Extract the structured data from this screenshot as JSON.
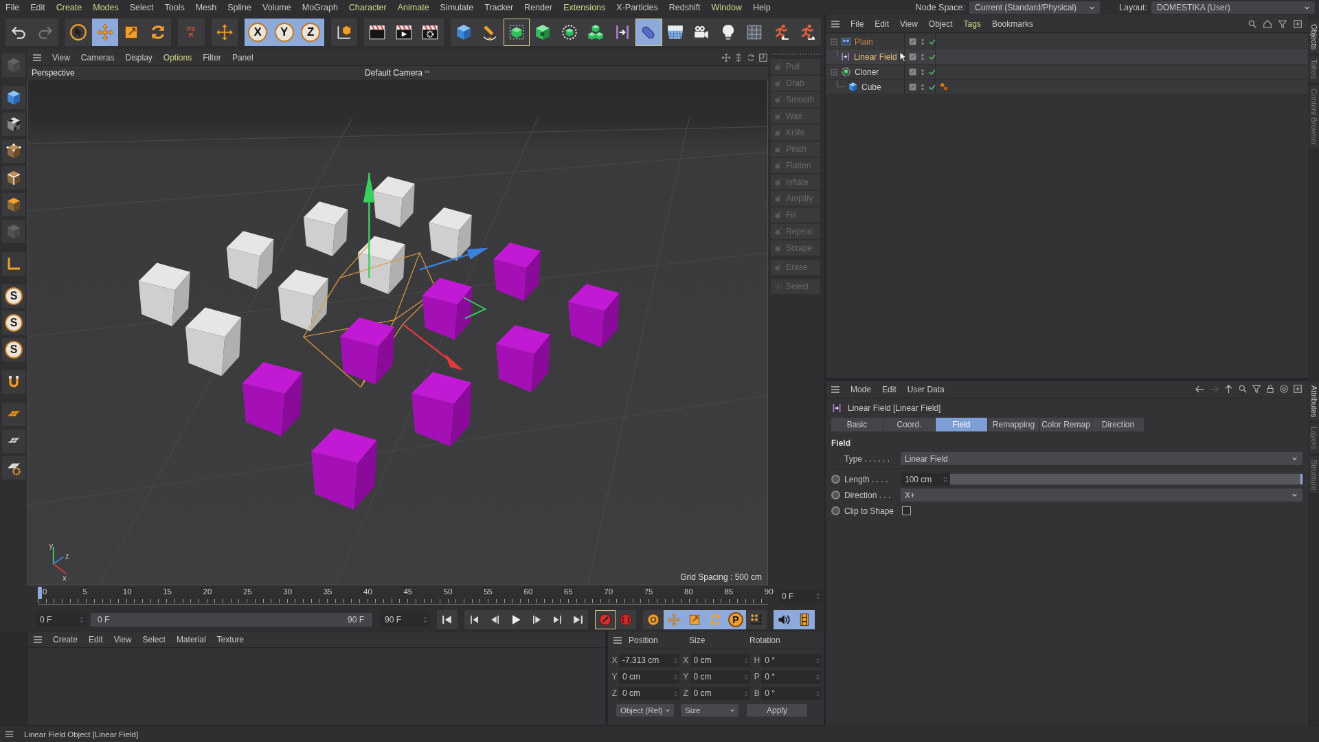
{
  "menu_bar": [
    {
      "label": "File",
      "highlighted": false
    },
    {
      "label": "Edit",
      "highlighted": false
    },
    {
      "label": "Create",
      "highlighted": true
    },
    {
      "label": "Modes",
      "highlighted": true
    },
    {
      "label": "Select",
      "highlighted": false
    },
    {
      "label": "Tools",
      "highlighted": false
    },
    {
      "label": "Mesh",
      "highlighted": false
    },
    {
      "label": "Spline",
      "highlighted": false
    },
    {
      "label": "Volume",
      "highlighted": false
    },
    {
      "label": "MoGraph",
      "highlighted": false
    },
    {
      "label": "Character",
      "highlighted": true
    },
    {
      "label": "Animate",
      "highlighted": true
    },
    {
      "label": "Simulate",
      "highlighted": false
    },
    {
      "label": "Tracker",
      "highlighted": false
    },
    {
      "label": "Render",
      "highlighted": false
    },
    {
      "label": "Extensions",
      "highlighted": true
    },
    {
      "label": "X-Particles",
      "highlighted": false
    },
    {
      "label": "Redshift",
      "highlighted": false
    },
    {
      "label": "Window",
      "highlighted": true
    },
    {
      "label": "Help",
      "highlighted": false
    }
  ],
  "node_space": {
    "label": "Node Space:",
    "value": "Current (Standard/Physical)"
  },
  "layout": {
    "label": "Layout:",
    "value": "DOMESTIKA (User)"
  },
  "toolbar": [
    {
      "kind": "icon",
      "selected": false,
      "outlined": false,
      "disabled": false
    },
    {
      "kind": "icon",
      "selected": false,
      "outlined": false,
      "disabled": true
    },
    {
      "kind": "icon",
      "selected": false,
      "outlined": false,
      "disabled": false
    },
    {
      "kind": "icon",
      "selected": true,
      "outlined": false,
      "disabled": false
    },
    {
      "kind": "icon",
      "selected": false,
      "outlined": false,
      "disabled": false
    },
    {
      "kind": "icon",
      "selected": false,
      "outlined": false,
      "disabled": false
    },
    {
      "kind": "letter",
      "glyph": "PSR",
      "selected": false,
      "outlined": false,
      "disabled": false
    },
    {
      "kind": "icon",
      "selected": false,
      "outlined": false,
      "disabled": false
    },
    {
      "kind": "letter",
      "glyph": "X",
      "selected": true,
      "outlined": false,
      "disabled": false
    },
    {
      "kind": "letter",
      "glyph": "Y",
      "selected": true,
      "outlined": false,
      "disabled": false
    },
    {
      "kind": "letter",
      "glyph": "Z",
      "selected": true,
      "outlined": false,
      "disabled": false
    },
    {
      "kind": "icon",
      "selected": false,
      "outlined": false,
      "disabled": false
    },
    {
      "kind": "icon",
      "selected": false,
      "outlined": false,
      "disabled": false
    },
    {
      "kind": "icon",
      "selected": false,
      "outlined": false,
      "disabled": false
    },
    {
      "kind": "icon",
      "selected": false,
      "outlined": false,
      "disabled": false
    },
    {
      "kind": "icon",
      "selected": false,
      "outlined": false,
      "disabled": false
    },
    {
      "kind": "icon",
      "selected": false,
      "outlined": false,
      "disabled": false
    },
    {
      "kind": "icon",
      "selected": false,
      "outlined": true,
      "disabled": false
    },
    {
      "kind": "icon",
      "selected": false,
      "outlined": false,
      "disabled": false
    },
    {
      "kind": "icon",
      "selected": false,
      "outlined": false,
      "disabled": false
    },
    {
      "kind": "icon",
      "selected": false,
      "outlined": false,
      "disabled": false
    },
    {
      "kind": "icon",
      "selected": false,
      "outlined": false,
      "disabled": false
    },
    {
      "kind": "icon",
      "selected": true,
      "outlined": true,
      "disabled": false
    },
    {
      "kind": "icon",
      "selected": false,
      "outlined": false,
      "disabled": false
    },
    {
      "kind": "icon",
      "selected": false,
      "outlined": false,
      "disabled": false
    },
    {
      "kind": "icon",
      "selected": false,
      "outlined": false,
      "disabled": false
    },
    {
      "kind": "icon",
      "selected": false,
      "outlined": false,
      "disabled": false
    },
    {
      "kind": "icon",
      "selected": false,
      "outlined": false,
      "disabled": false
    },
    {
      "kind": "icon",
      "selected": false,
      "outlined": false,
      "disabled": false
    }
  ],
  "left_toolbar": [
    {
      "kind": "icon"
    },
    {
      "kind": "icon"
    },
    {
      "kind": "icon"
    },
    {
      "kind": "icon"
    },
    {
      "kind": "icon"
    },
    {
      "kind": "icon"
    },
    {
      "kind": "icon"
    },
    {
      "kind": "icon"
    },
    {
      "kind": "letter",
      "glyph": "S"
    },
    {
      "kind": "letter",
      "glyph": "S"
    },
    {
      "kind": "letter",
      "glyph": "S"
    },
    {
      "kind": "icon"
    },
    {
      "kind": "icon"
    },
    {
      "kind": "icon"
    },
    {
      "kind": "icon"
    }
  ],
  "viewport": {
    "menu": [
      {
        "label": "View",
        "highlighted": false
      },
      {
        "label": "Cameras",
        "highlighted": false
      },
      {
        "label": "Display",
        "highlighted": false
      },
      {
        "label": "Options",
        "highlighted": true
      },
      {
        "label": "Filter",
        "highlighted": false
      },
      {
        "label": "Panel",
        "highlighted": false
      }
    ],
    "view_name": "Perspective",
    "camera": "Default Camera",
    "grid_spacing": "Grid Spacing : 500 cm",
    "axis_labels": [
      "y",
      "z",
      "x"
    ]
  },
  "sculpt_tools": [
    [
      {
        "label": "Pull",
        "disabled": true
      },
      {
        "label": "Grab",
        "disabled": true
      },
      {
        "label": "Smooth",
        "disabled": true
      },
      {
        "label": "Wax",
        "disabled": true
      },
      {
        "label": "Knife",
        "disabled": true
      },
      {
        "label": "Pinch",
        "disabled": true
      },
      {
        "label": "Flatten",
        "disabled": true
      },
      {
        "label": "Inflate",
        "disabled": true
      },
      {
        "label": "Amplify",
        "disabled": true
      },
      {
        "label": "Fill",
        "disabled": true
      },
      {
        "label": "Repeat",
        "disabled": true
      },
      {
        "label": "Scrape",
        "disabled": true
      }
    ],
    [
      {
        "label": "Erase",
        "disabled": true
      }
    ],
    [
      {
        "label": "Select",
        "disabled": true
      }
    ]
  ],
  "object_manager": {
    "menu": [
      {
        "label": "File",
        "highlighted": false
      },
      {
        "label": "Edit",
        "highlighted": false
      },
      {
        "label": "View",
        "highlighted": false
      },
      {
        "label": "Object",
        "highlighted": false
      },
      {
        "label": "Tags",
        "highlighted": true
      },
      {
        "label": "Bookmarks",
        "highlighted": false
      }
    ],
    "objects": [
      {
        "name": "Plain",
        "color": "#c4844a",
        "selected": false,
        "expanded": true,
        "enabled": true,
        "tag": false,
        "children": [
          {
            "name": "Linear Field",
            "color": "#e8c07a",
            "selected": true,
            "enabled": true,
            "tag": false
          }
        ]
      },
      {
        "name": "Cloner",
        "color": "#cfcfcf",
        "selected": false,
        "expanded": true,
        "enabled": true,
        "tag": false,
        "children": [
          {
            "name": "Cube",
            "color": "#cfcfcf",
            "selected": false,
            "enabled": true,
            "tag": true
          }
        ]
      }
    ]
  },
  "side_tabs_top": [
    "Objects",
    "Takes",
    "Content Browser"
  ],
  "attributes": {
    "menu": [
      {
        "label": "Mode",
        "highlighted": false
      },
      {
        "label": "Edit",
        "highlighted": false
      },
      {
        "label": "User Data",
        "highlighted": false
      }
    ],
    "title": "Linear Field [Linear Field]",
    "tabs": [
      {
        "label": "Basic",
        "selected": false
      },
      {
        "label": "Coord.",
        "selected": false
      },
      {
        "label": "Field",
        "selected": true
      },
      {
        "label": "Remapping",
        "selected": false
      },
      {
        "label": "Color Remap",
        "selected": false
      },
      {
        "label": "Direction",
        "selected": false
      }
    ],
    "section": "Field",
    "params": [
      {
        "kind": "dropdown",
        "label": "Type . . . . . .",
        "value": "Linear Field",
        "animatable": false
      },
      {
        "kind": "slider",
        "label": "Length . . . .",
        "value": "100 cm",
        "level": 1,
        "animatable": true
      },
      {
        "kind": "dropdown",
        "label": "Direction . . .",
        "value": "X+",
        "animatable": true
      },
      {
        "kind": "checkbox",
        "label": "Clip to Shape",
        "checked": false,
        "animatable": true
      }
    ]
  },
  "side_tabs_bottom": [
    "Attributes",
    "Layers",
    "Structure"
  ],
  "timeline": {
    "frames": [
      "0",
      "5",
      "10",
      "15",
      "20",
      "25",
      "30",
      "35",
      "40",
      "45",
      "50",
      "55",
      "60",
      "65",
      "70",
      "75",
      "80",
      "85",
      "90"
    ],
    "playhead": {
      "level": 0
    },
    "current_frame": "0 F",
    "start": "0 F",
    "range_start": "0 F",
    "range_end": "90 F",
    "end": "90 F",
    "buttons": [
      {
        "kind": "icon",
        "selected": false,
        "outlined": false
      },
      {
        "kind": "icon",
        "selected": false,
        "outlined": false
      },
      {
        "kind": "icon",
        "selected": false,
        "outlined": false
      },
      {
        "kind": "icon",
        "selected": false,
        "outlined": false
      },
      {
        "kind": "icon",
        "selected": false,
        "outlined": false
      },
      {
        "kind": "icon",
        "selected": false,
        "outlined": false
      },
      {
        "kind": "icon",
        "selected": false,
        "outlined": false
      },
      {
        "kind": "icon",
        "selected": false,
        "outlined": true
      },
      {
        "kind": "icon",
        "selected": false,
        "outlined": false
      },
      {
        "kind": "icon",
        "selected": false,
        "outlined": false
      },
      {
        "kind": "icon",
        "selected": true,
        "outlined": false
      },
      {
        "kind": "icon",
        "selected": true,
        "outlined": false
      },
      {
        "kind": "icon",
        "selected": true,
        "outlined": false
      },
      {
        "kind": "letter",
        "glyph": "P",
        "selected": true,
        "outlined": false
      },
      {
        "kind": "icon",
        "selected": false,
        "outlined": false
      },
      {
        "kind": "icon",
        "selected": true,
        "outlined": false
      },
      {
        "kind": "icon",
        "selected": true,
        "outlined": false
      }
    ]
  },
  "material_manager": {
    "menu": [
      {
        "label": "Create",
        "highlighted": false
      },
      {
        "label": "Edit",
        "highlighted": false
      },
      {
        "label": "View",
        "highlighted": false
      },
      {
        "label": "Select",
        "highlighted": false
      },
      {
        "label": "Material",
        "highlighted": false
      },
      {
        "label": "Texture",
        "highlighted": false
      }
    ]
  },
  "coordinates": {
    "headers": [
      "Position",
      "Size",
      "Rotation"
    ],
    "rows": [
      {
        "position_axis": "X",
        "position": "-7.313 cm",
        "size_axis": "X",
        "size": "0 cm",
        "rotation_axis": "H",
        "rotation": "0 °"
      },
      {
        "position_axis": "Y",
        "position": "0 cm",
        "size_axis": "Y",
        "size": "0 cm",
        "rotation_axis": "P",
        "rotation": "0 °"
      },
      {
        "position_axis": "Z",
        "position": "0 cm",
        "size_axis": "Z",
        "size": "0 cm",
        "rotation_axis": "B",
        "rotation": "0 °"
      }
    ],
    "mode": "Object (Rel)",
    "size_mode": "Size",
    "apply": "Apply"
  },
  "status_bar": "Linear Field Object [Linear Field]"
}
